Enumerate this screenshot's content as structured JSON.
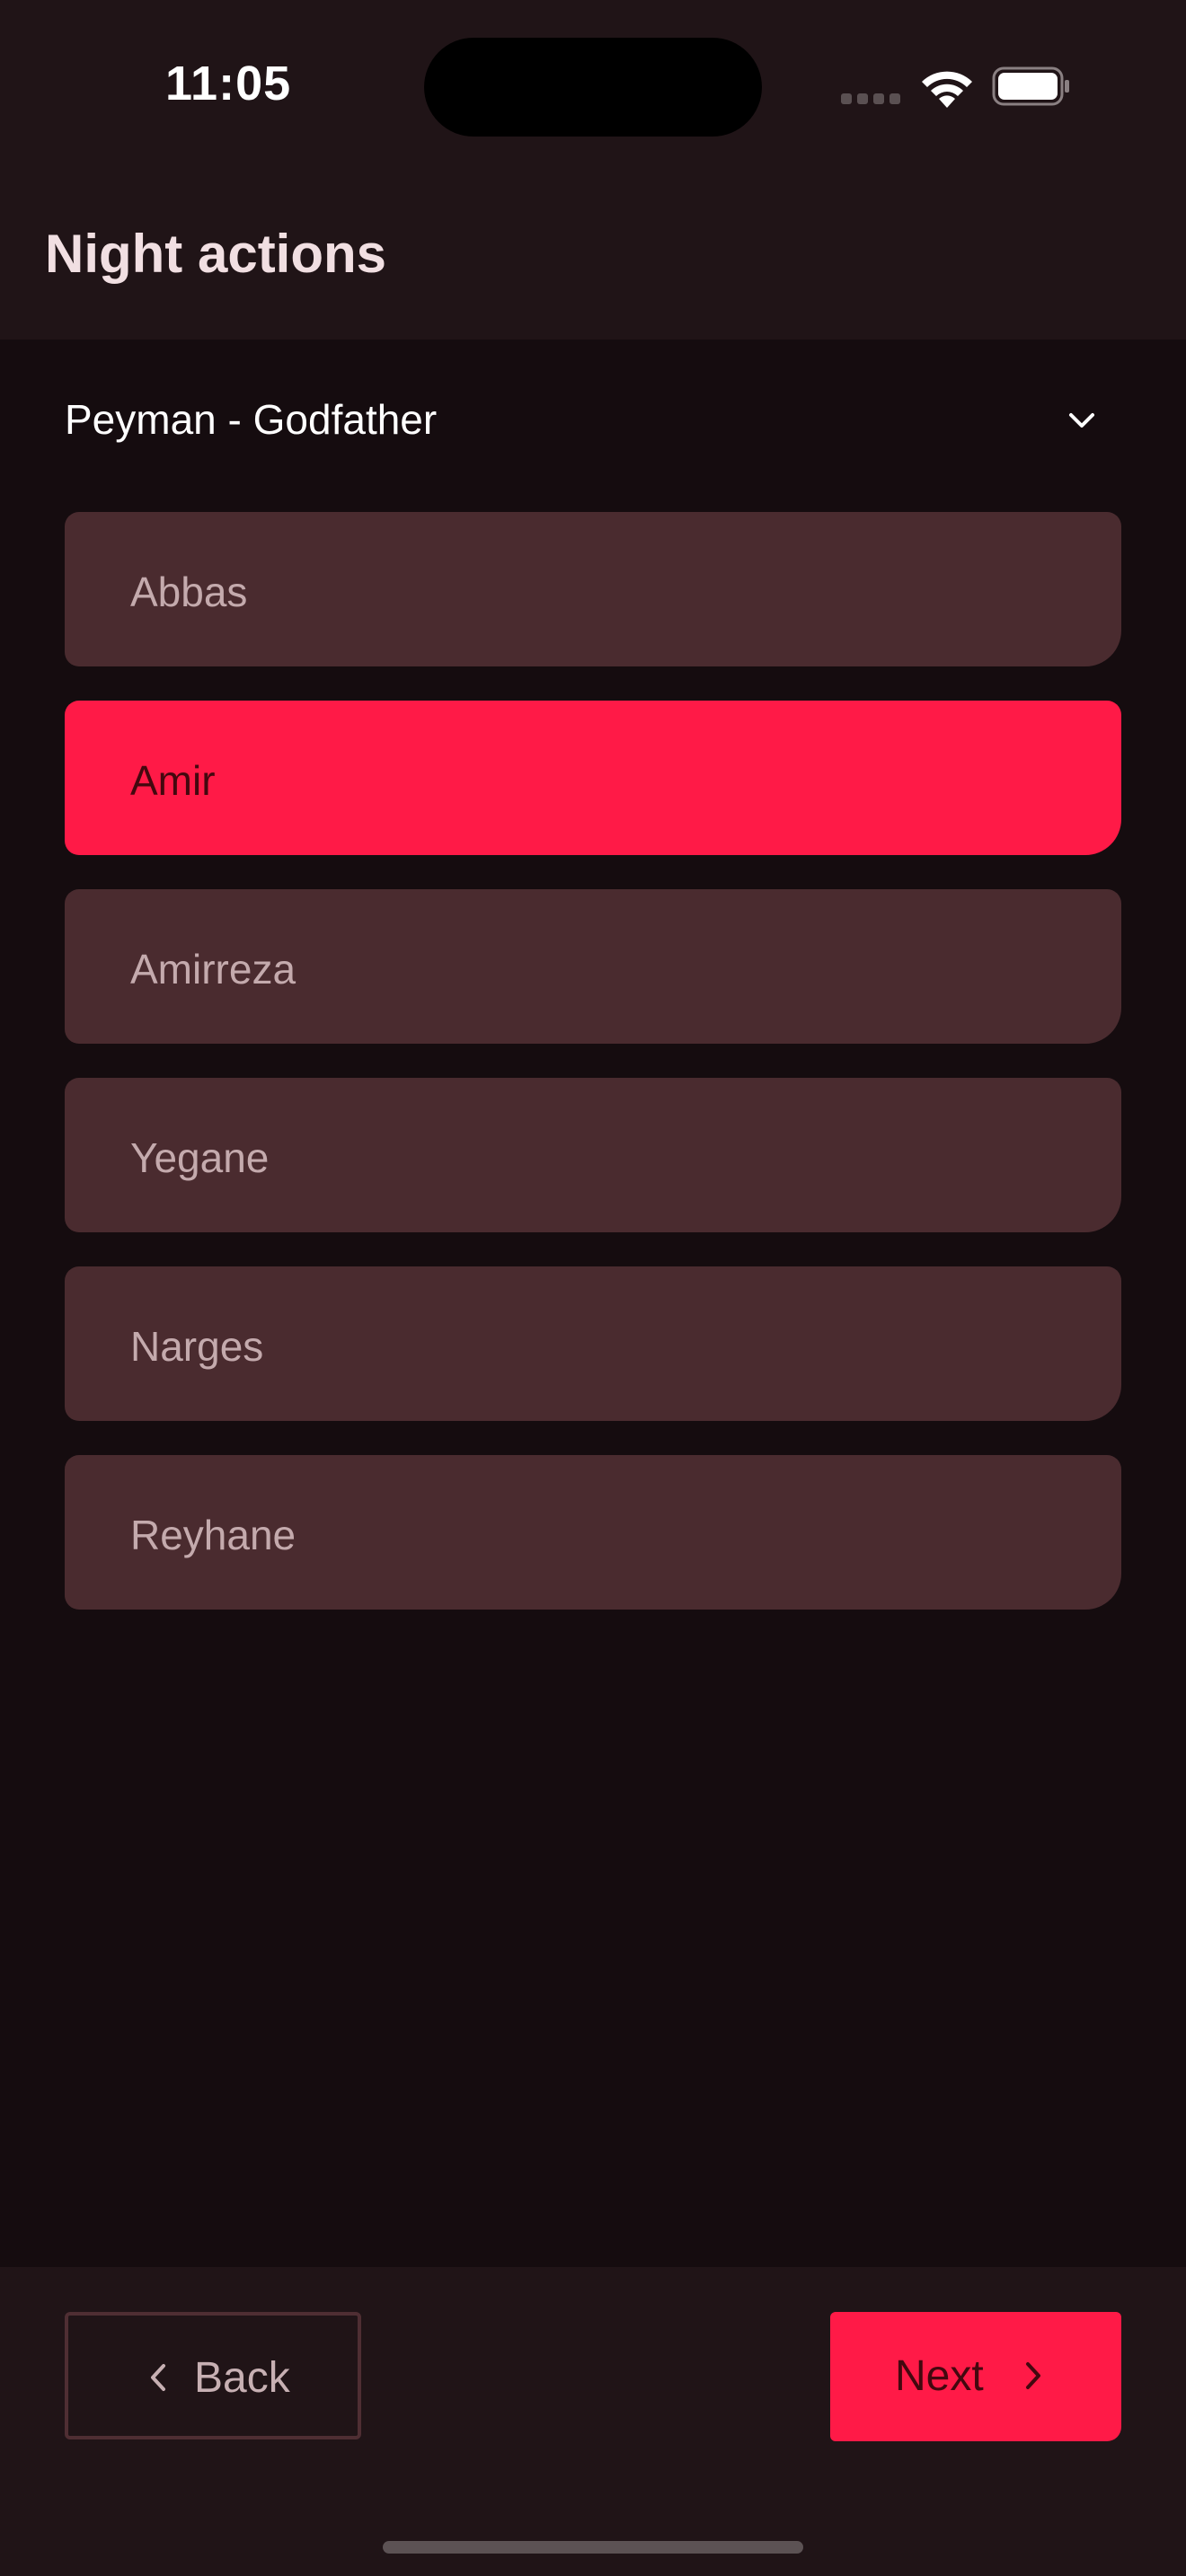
{
  "status": {
    "time": "11:05",
    "icons": [
      "cellular-signal-icon",
      "wifi-icon",
      "battery-icon"
    ]
  },
  "header": {
    "title": "Night actions"
  },
  "dropdown": {
    "selected": "Peyman - Godfather",
    "icon": "chevron-down-icon"
  },
  "players": [
    {
      "name": "Abbas",
      "selected": false
    },
    {
      "name": "Amir",
      "selected": true
    },
    {
      "name": "Amirreza",
      "selected": false
    },
    {
      "name": "Yegane",
      "selected": false
    },
    {
      "name": "Narges",
      "selected": false
    },
    {
      "name": "Reyhane",
      "selected": false
    }
  ],
  "footer": {
    "back_label": "Back",
    "back_icon": "chevron-left-icon",
    "next_label": "Next",
    "next_icon": "chevron-right-icon"
  },
  "colors": {
    "background": "#150c0f",
    "surface": "#201417",
    "item": "#4a2b2f",
    "accent": "#ff1a47",
    "item_text": "#c4aaad",
    "title_text": "#f1dfe2"
  }
}
